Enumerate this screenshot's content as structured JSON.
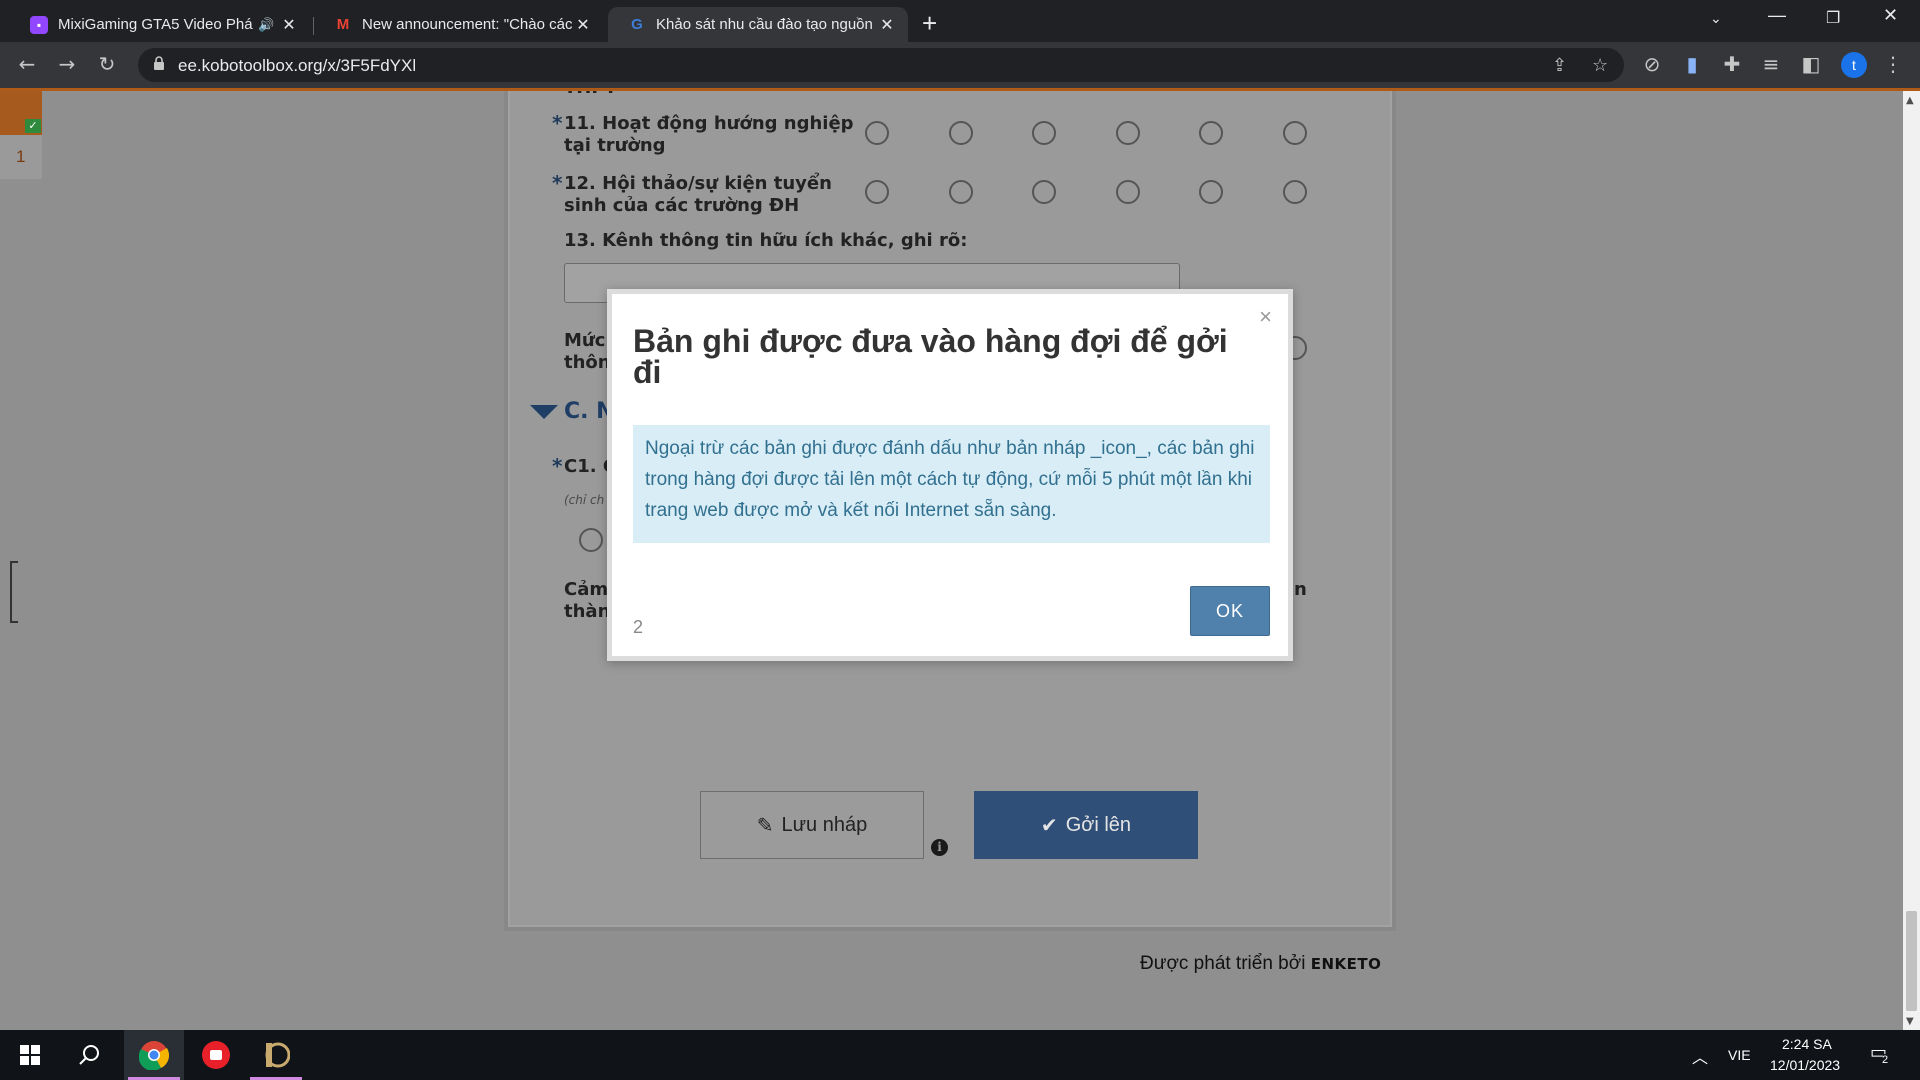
{
  "browser": {
    "tabs": [
      {
        "title": "MixiGaming GTA5 Video Phá",
        "favicon": "twitch-icon",
        "audio": true
      },
      {
        "title": "New announcement: \"Chào các e",
        "favicon": "gmail-icon"
      },
      {
        "title": "Khảo sát nhu cầu đào tạo nguồn",
        "favicon": "kobo-icon",
        "active": true
      }
    ],
    "new_tab": "+",
    "url": "ee.kobotoolbox.org/x/3F5FdYXl",
    "profile_initial": "t"
  },
  "form": {
    "partial_top": "THPT",
    "questions": [
      {
        "label_line1": "11. Hoạt động hướng nghiệp",
        "label_line2": "tại trường",
        "required": "*"
      },
      {
        "label_line1": "12. Hội thảo/sự kiện tuyển",
        "label_line2": "sinh của các trường ĐH",
        "required": "*"
      }
    ],
    "q13": "13. Kênh thông tin hữu ích khác, ghi rõ:",
    "partial_rating_line1": "Mức",
    "partial_rating_line2": "thôn",
    "section_c": "C. N",
    "c1_label": "C1. C",
    "c1_hint": "(chỉ ch",
    "thanks_line1": "Cảm",
    "thanks_line2": "thàn",
    "thanks_suffix": "n",
    "save_draft": "Lưu nháp",
    "submit": "Gởi lên",
    "powered_by": "Được phát triển bởi",
    "powered_brand": "ENKETO",
    "side_counter": "1"
  },
  "modal": {
    "title": "Bản ghi được đưa vào hàng đợi để gởi đi",
    "message": "Ngoại trừ các bản ghi được đánh dấu như bản nháp _icon_, các bản ghi trong hàng đợi được tải lên một cách tự động, cứ mỗi 5 phút một lần khi trang web được mở và kết nối Internet sẵn sàng.",
    "ok": "OK",
    "pager": "2",
    "close": "×"
  },
  "taskbar": {
    "language": "VIE",
    "time": "2:24 SA",
    "date": "12/01/2023",
    "notifications": "2"
  },
  "colors": {
    "accent": "#304f78",
    "modal_info_bg": "#d9edf7",
    "modal_info_text": "#31708f",
    "ok_button": "#4f81ac"
  }
}
